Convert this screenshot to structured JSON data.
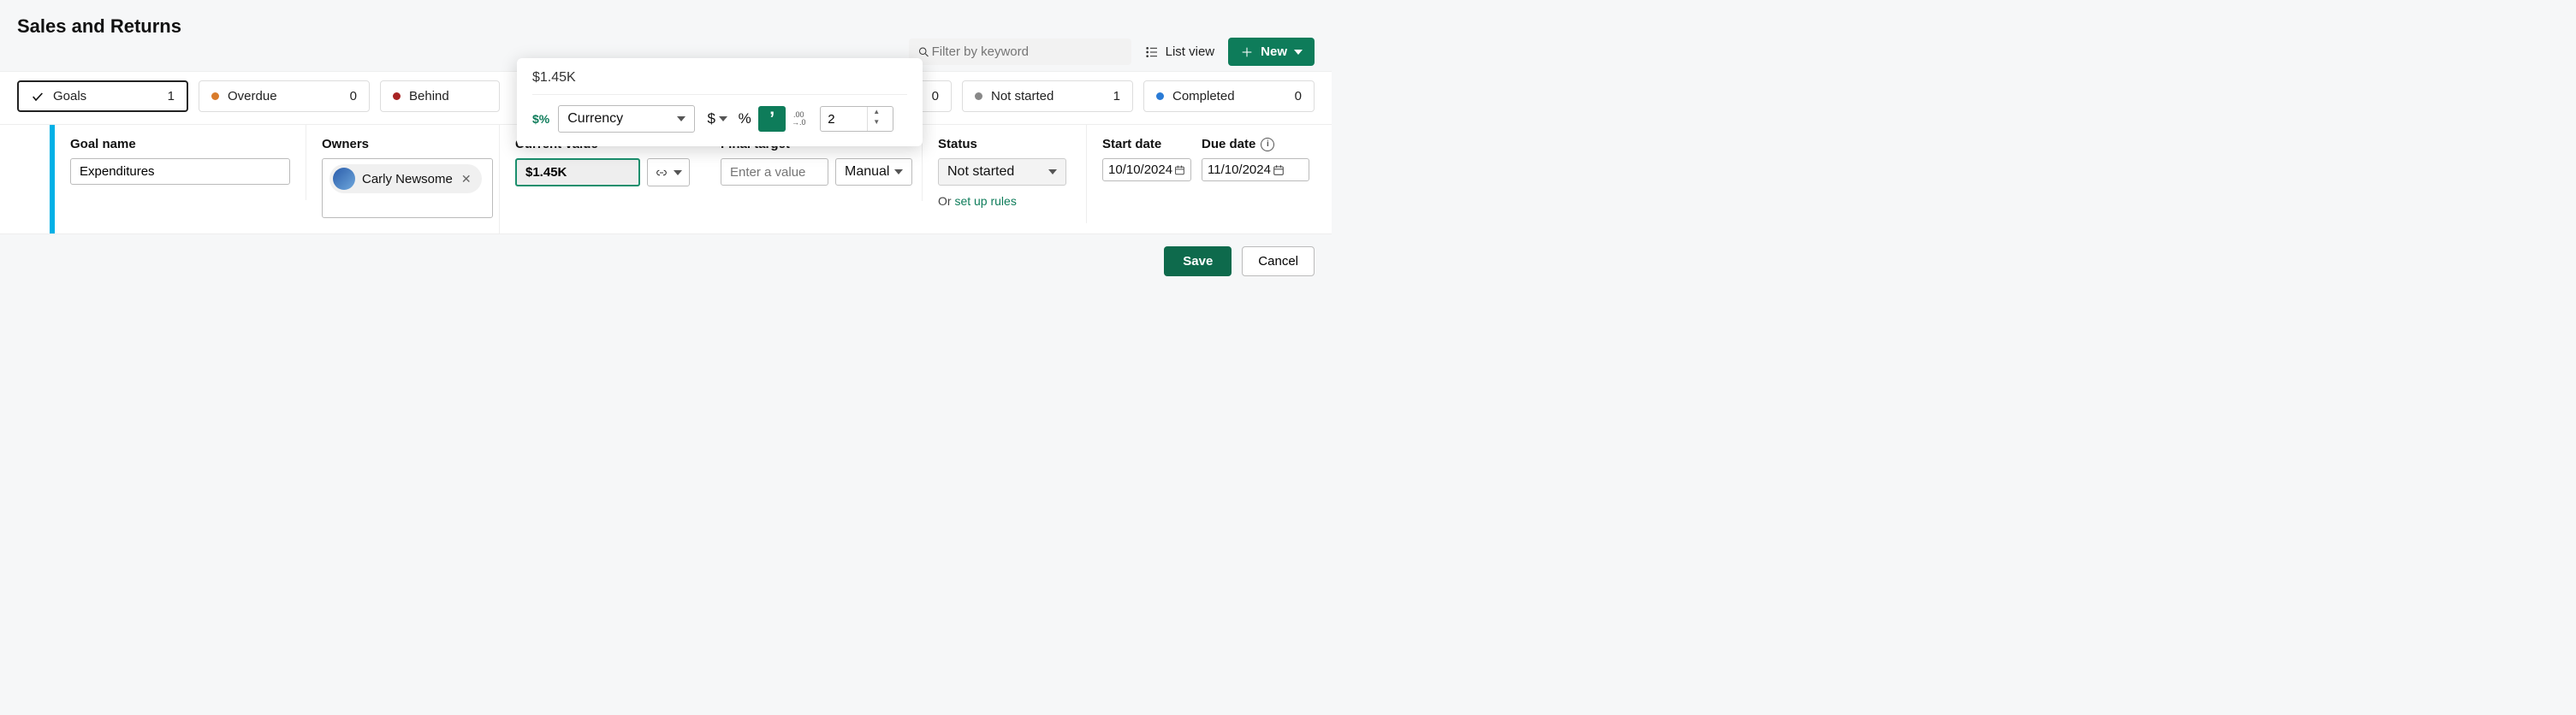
{
  "page": {
    "title": "Sales and Returns"
  },
  "toolbar": {
    "search_placeholder": "Filter by keyword",
    "list_view_label": "List view",
    "new_label": "New"
  },
  "filters": {
    "goals": {
      "label": "Goals",
      "count": "1"
    },
    "overdue": {
      "label": "Overdue",
      "count": "0"
    },
    "behind": {
      "label": "Behind",
      "count": ""
    },
    "hidden_partial": {
      "count": "0"
    },
    "not_started": {
      "label": "Not started",
      "count": "1"
    },
    "completed": {
      "label": "Completed",
      "count": "0"
    }
  },
  "form": {
    "goal_name": {
      "label": "Goal name",
      "value": "Expenditures"
    },
    "owners": {
      "label": "Owners",
      "person": "Carly Newsome"
    },
    "current_value": {
      "label": "Current value",
      "value": "$1.45K"
    },
    "final_target": {
      "label": "Final target",
      "placeholder": "Enter a value",
      "mode": "Manual"
    },
    "status": {
      "label": "Status",
      "value": "Not started",
      "or_text": "Or ",
      "rules_link": "set up rules"
    },
    "start_date": {
      "label": "Start date",
      "value": "10/10/2024"
    },
    "due_date": {
      "label": "Due date",
      "value": "11/10/2024"
    }
  },
  "popover": {
    "preview_value": "$1.45K",
    "format_label": "Currency",
    "currency_symbol": "$",
    "percent_symbol": "%",
    "thousands_symbol": "’",
    "decimal_icon_top": ".00",
    "decimal_icon_bottom": "→.0",
    "decimals_value": "2"
  },
  "actions": {
    "save": "Save",
    "cancel": "Cancel"
  }
}
